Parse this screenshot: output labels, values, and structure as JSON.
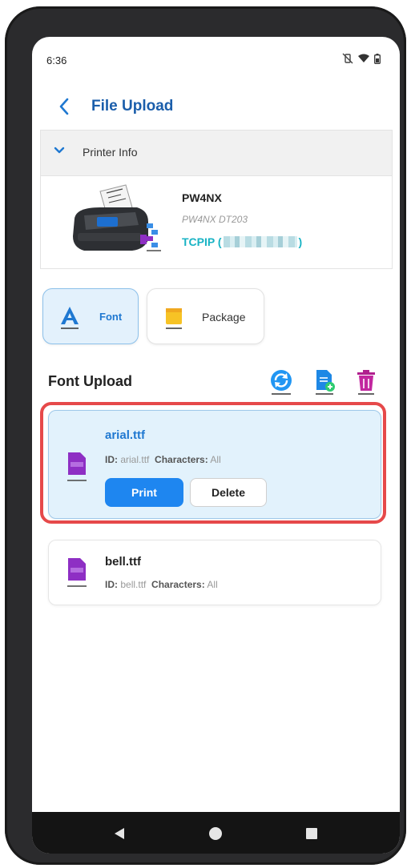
{
  "status_bar": {
    "time": "6:36"
  },
  "app_bar": {
    "title": "File Upload"
  },
  "printer_info": {
    "header_label": "Printer Info",
    "name": "PW4NX",
    "model": "PW4NX DT203",
    "connection_prefix": "TCPIP (",
    "connection_suffix": ")"
  },
  "upload_types": [
    {
      "label": "Font",
      "selected": true
    },
    {
      "label": "Package",
      "selected": false
    }
  ],
  "section": {
    "title": "Font Upload"
  },
  "labels": {
    "id": "ID:",
    "characters": "Characters:"
  },
  "files": [
    {
      "name": "arial.ttf",
      "id": "arial.ttf",
      "characters": "All",
      "selected": true,
      "print_label": "Print",
      "delete_label": "Delete"
    },
    {
      "name": "bell.ttf",
      "id": "bell.ttf",
      "characters": "All",
      "selected": false
    }
  ],
  "colors": {
    "title_blue": "#1b5eab",
    "accent_blue": "#1e86f0",
    "tcpip_teal": "#18b3c4",
    "file_purple": "#8e2fc4",
    "highlight_red": "#e6494a"
  }
}
